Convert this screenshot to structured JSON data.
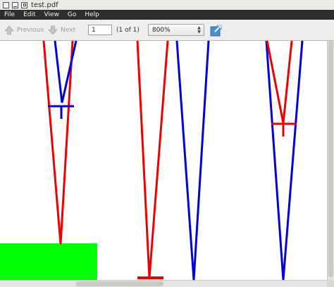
{
  "window": {
    "title": "test.pdf"
  },
  "menu": {
    "items": [
      "File",
      "Edit",
      "View",
      "Go",
      "Help"
    ]
  },
  "toolbar": {
    "previous_label": "Previous",
    "next_label": "Next",
    "page_value": "1",
    "page_count": "(1 of 1)",
    "zoom_value": "800%",
    "icons": [
      "arrow-up-icon",
      "arrow-down-icon",
      "fit-page-icon"
    ]
  },
  "colors": {
    "red": "#ee0000",
    "blue": "#0000dd",
    "green": "#00ff00",
    "menubar": "#2e2e2e"
  }
}
